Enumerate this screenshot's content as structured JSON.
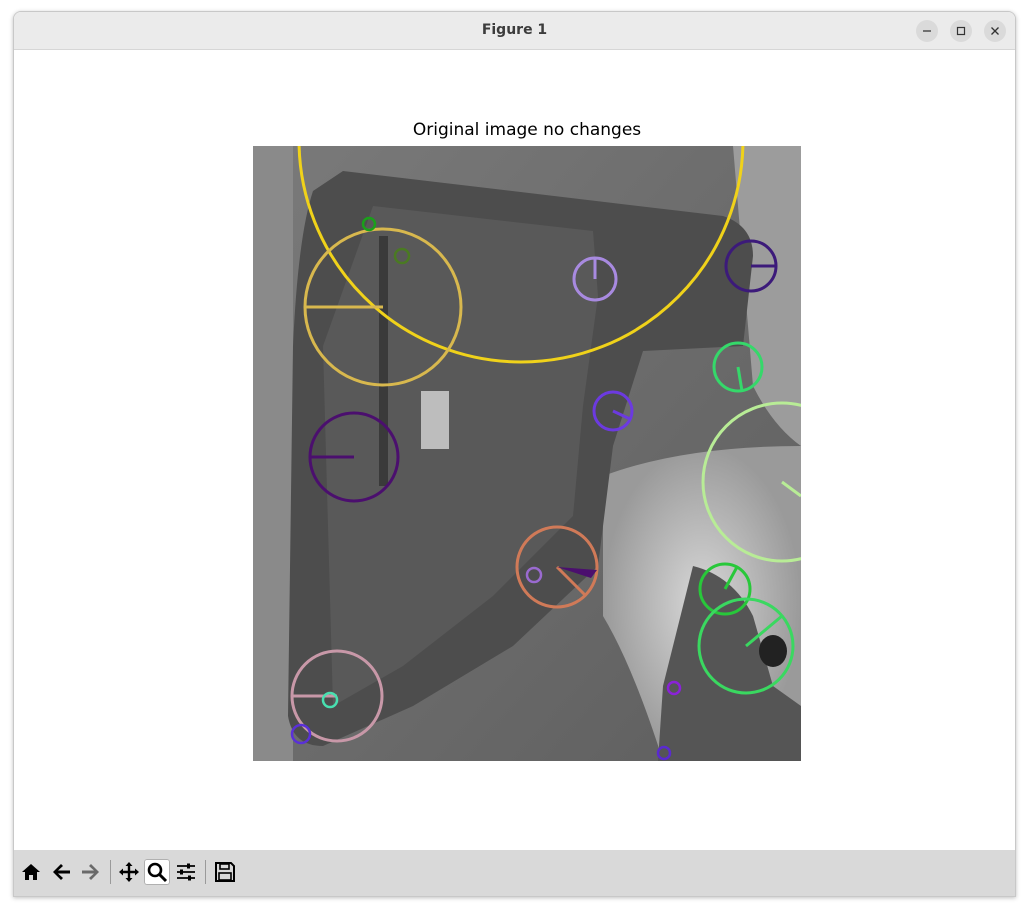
{
  "window": {
    "title": "Figure 1",
    "controls": [
      "minimize-icon",
      "maximize-icon",
      "close-icon"
    ]
  },
  "figure": {
    "title": "Original image no changes",
    "image": {
      "description_icon": "grayscale-photo",
      "background_color": "#6e6e6e"
    },
    "keypoints": [
      {
        "color": "#f0d21a",
        "size": "large"
      },
      {
        "color": "#d8b84e",
        "size": "medium"
      },
      {
        "color": "#4b0f6e",
        "size": "medium"
      },
      {
        "color": "#a88ae0",
        "size": "small"
      },
      {
        "color": "#3c1a7a",
        "size": "small"
      },
      {
        "color": "#35d86a",
        "size": "small"
      },
      {
        "color": "#6c3ae0",
        "size": "small"
      },
      {
        "color": "#b8ec96",
        "size": "large"
      },
      {
        "color": "#d07a58",
        "size": "medium"
      },
      {
        "color": "#28c83a",
        "size": "small"
      },
      {
        "color": "#3ad860",
        "size": "medium"
      },
      {
        "color": "#c898a8",
        "size": "medium"
      }
    ]
  },
  "toolbar": {
    "tools": [
      {
        "name": "home-icon",
        "active": false
      },
      {
        "name": "back-icon",
        "active": false
      },
      {
        "name": "forward-icon",
        "active": false
      },
      {
        "name": "pan-icon",
        "active": false
      },
      {
        "name": "zoom-icon",
        "active": true
      },
      {
        "name": "configure-subplots-icon",
        "active": false
      },
      {
        "name": "save-icon",
        "active": false
      }
    ]
  }
}
